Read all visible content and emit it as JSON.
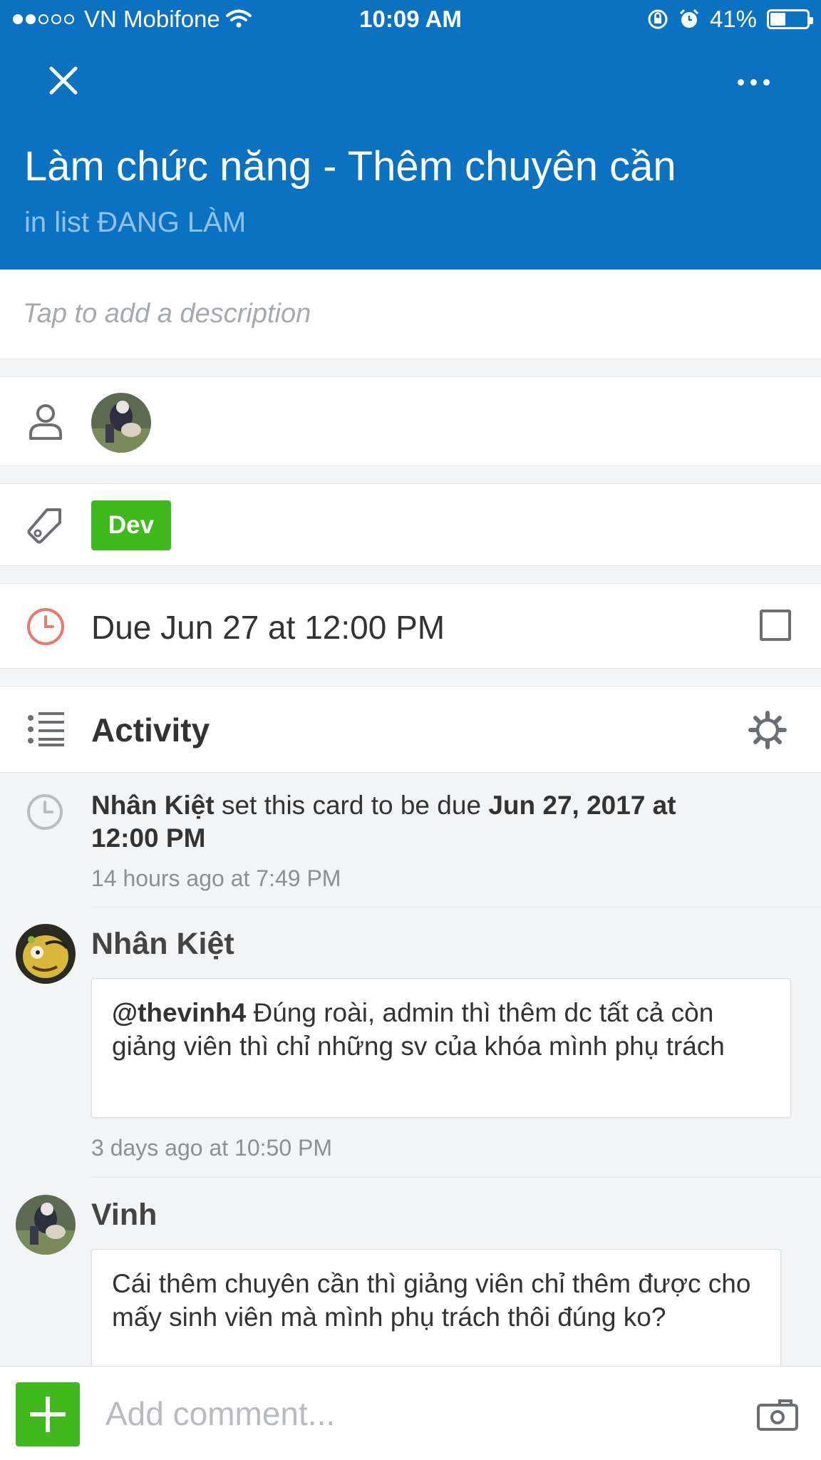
{
  "status_bar": {
    "carrier": "VN Mobifone",
    "time": "10:09 AM",
    "battery": "41%",
    "battery_level": 0.41,
    "signal_bars_filled": 2,
    "signal_bars_total": 5
  },
  "header": {
    "title": "Làm chức năng - Thêm chuyên cần",
    "list_label": "in list ĐANG LÀM",
    "background_color": "#0a72c1"
  },
  "description": {
    "placeholder": "Tap to add a description"
  },
  "labels": [
    {
      "text": "Dev",
      "color": "#3fb91b"
    }
  ],
  "due": {
    "text": "Due Jun 27 at 12:00 PM",
    "completed": false
  },
  "activity": {
    "title": "Activity",
    "items": [
      {
        "type": "event",
        "actor": "Nhân Kiệt",
        "action": " set this card to be due ",
        "target_line1": "Jun 27, 2017 at",
        "target_line2": "12:00 PM",
        "time": "14 hours ago at 7:49 PM"
      },
      {
        "type": "comment",
        "author": "Nhân Kiệt",
        "mention": "@thevinh4",
        "text": " Đúng roài, admin thì thêm dc tất cả còn giảng viên thì chỉ những sv của khóa mình phụ trách",
        "time": "3 days ago at 10:50 PM"
      },
      {
        "type": "comment",
        "author": "Vinh",
        "text": "Cái thêm chuyên cần thì giảng viên chỉ thêm được cho mấy sinh viên mà mình phụ trách thôi đúng ko?"
      }
    ]
  },
  "comment_bar": {
    "placeholder": "Add comment..."
  },
  "icons": {
    "close": "close-icon",
    "more": "more-icon",
    "member": "person-icon",
    "label": "tag-icon",
    "due": "clock-icon",
    "activity": "list-icon",
    "settings": "gear-icon",
    "attach": "camera-icon"
  }
}
